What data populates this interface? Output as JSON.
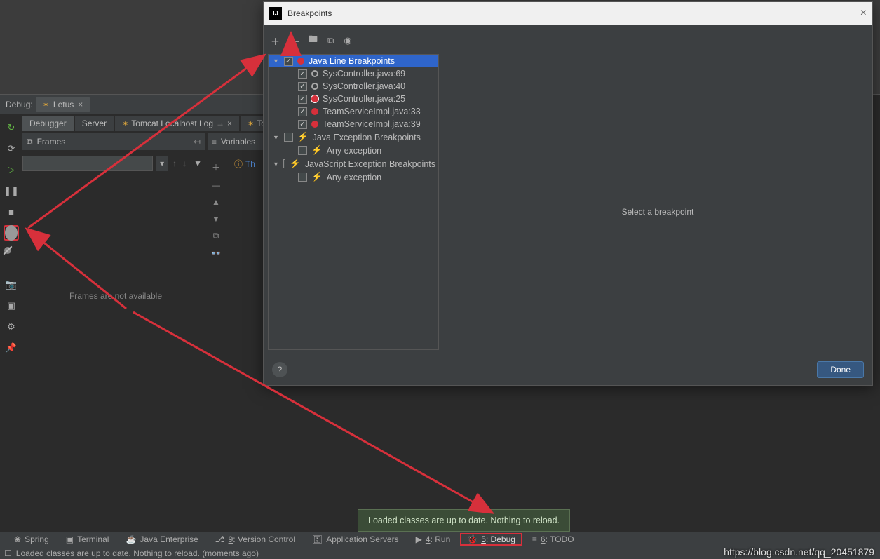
{
  "editor": {},
  "debug": {
    "label": "Debug:",
    "tab_name": "Letus",
    "subtabs": {
      "debugger": "Debugger",
      "server": "Server",
      "log": "Tomcat Localhost Log",
      "tom": "Tom"
    },
    "frames_hdr": "Frames",
    "vars_hdr": "Variables",
    "th_label": "Th",
    "frames_empty": "Frames are not available"
  },
  "dialog": {
    "title": "Breakpoints",
    "java_line": "Java Line Breakpoints",
    "items": [
      {
        "label": "SysController.java:69",
        "kind": "disabled"
      },
      {
        "label": "SysController.java:40",
        "kind": "disabled"
      },
      {
        "label": "SysController.java:25",
        "kind": "red_b"
      },
      {
        "label": "TeamServiceImpl.java:33",
        "kind": "red"
      },
      {
        "label": "TeamServiceImpl.java:39",
        "kind": "red"
      }
    ],
    "java_ex": "Java Exception Breakpoints",
    "any_ex": "Any exception",
    "js_ex": "JavaScript Exception Breakpoints",
    "right_placeholder": "Select a breakpoint",
    "done": "Done"
  },
  "tooltip": "Loaded classes are up to date. Nothing to reload.",
  "bottom": [
    {
      "icon": "leaf",
      "label": "Spring",
      "sel": false
    },
    {
      "icon": "term",
      "label": "Terminal",
      "sel": false
    },
    {
      "icon": "cup",
      "label": "Java Enterprise",
      "sel": false
    },
    {
      "icon": "branch",
      "u": "9",
      "label": ": Version Control",
      "sel": false
    },
    {
      "icon": "srv",
      "label": "Application Servers",
      "sel": false
    },
    {
      "icon": "play",
      "u": "4",
      "label": ": Run",
      "sel": false
    },
    {
      "icon": "bug",
      "u": "5",
      "label": ": Debug",
      "sel": true
    },
    {
      "icon": "list",
      "u": "6",
      "label": ": TODO",
      "sel": false
    }
  ],
  "status": "Loaded classes are up to date. Nothing to reload. (moments ago)",
  "watermark": "https://blog.csdn.net/qq_20451879"
}
